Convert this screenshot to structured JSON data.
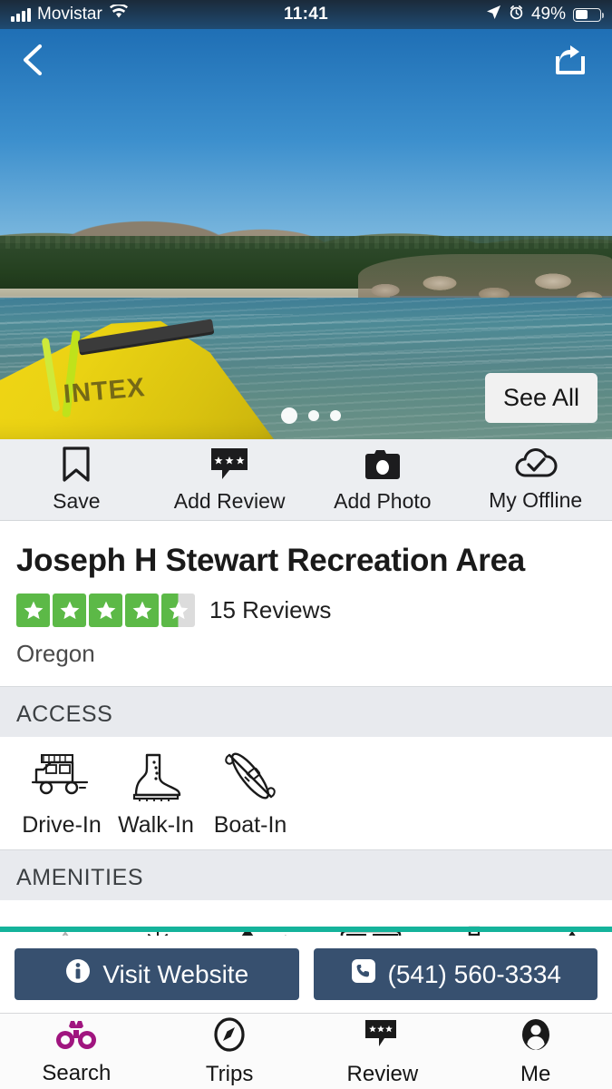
{
  "status_bar": {
    "carrier": "Movistar",
    "time": "11:41",
    "battery_percent": "49%",
    "icons": [
      "signal-bars-icon",
      "wifi-icon",
      "location-arrow-icon",
      "alarm-clock-icon",
      "battery-icon"
    ]
  },
  "hero": {
    "back_icon": "chevron-left-icon",
    "share_icon": "share-icon",
    "see_all_label": "See All",
    "photo_count_dots": 3,
    "active_dot": 1,
    "kayak_brand": "INTEX"
  },
  "action_bar": {
    "items": [
      {
        "label": "Save",
        "icon": "bookmark-icon"
      },
      {
        "label": "Add Review",
        "icon": "review-bubble-icon"
      },
      {
        "label": "Add Photo",
        "icon": "camera-icon"
      },
      {
        "label": "My Offline",
        "icon": "cloud-check-icon"
      }
    ]
  },
  "place": {
    "title": "Joseph H Stewart Recreation Area",
    "rating": 4.5,
    "stars_total": 5,
    "reviews_label": "15 Reviews",
    "region": "Oregon"
  },
  "sections": {
    "access": {
      "heading": "ACCESS",
      "items": [
        {
          "label": "Drive-In",
          "icon": "suv-icon"
        },
        {
          "label": "Walk-In",
          "icon": "hiking-boot-icon"
        },
        {
          "label": "Boat-In",
          "icon": "kayak-paddle-icon"
        }
      ]
    },
    "amenities": {
      "heading": "AMENITIES",
      "items": [
        {
          "icon": "mountains-icon"
        },
        {
          "icon": "sun-tent-icon"
        },
        {
          "icon": "tree-tent-icon"
        },
        {
          "icon": "rv-icon"
        },
        {
          "icon": "boat-dock-icon"
        },
        {
          "icon": "tent-icon"
        }
      ]
    }
  },
  "cta": {
    "website_label": "Visit Website",
    "website_icon": "info-icon",
    "phone_label": "(541) 560-3334",
    "phone_icon": "phone-icon"
  },
  "tab_bar": {
    "active": "Search",
    "items": [
      {
        "label": "Search",
        "icon": "binoculars-icon"
      },
      {
        "label": "Trips",
        "icon": "compass-icon"
      },
      {
        "label": "Review",
        "icon": "review-bubble-icon"
      },
      {
        "label": "Me",
        "icon": "person-avatar-icon"
      }
    ]
  },
  "colors": {
    "accent_magenta": "#a0157f",
    "cta_blue": "#37506f",
    "star_green": "#5cb947",
    "progress_teal": "#14b39b",
    "section_header_bg": "#e8eaee"
  }
}
